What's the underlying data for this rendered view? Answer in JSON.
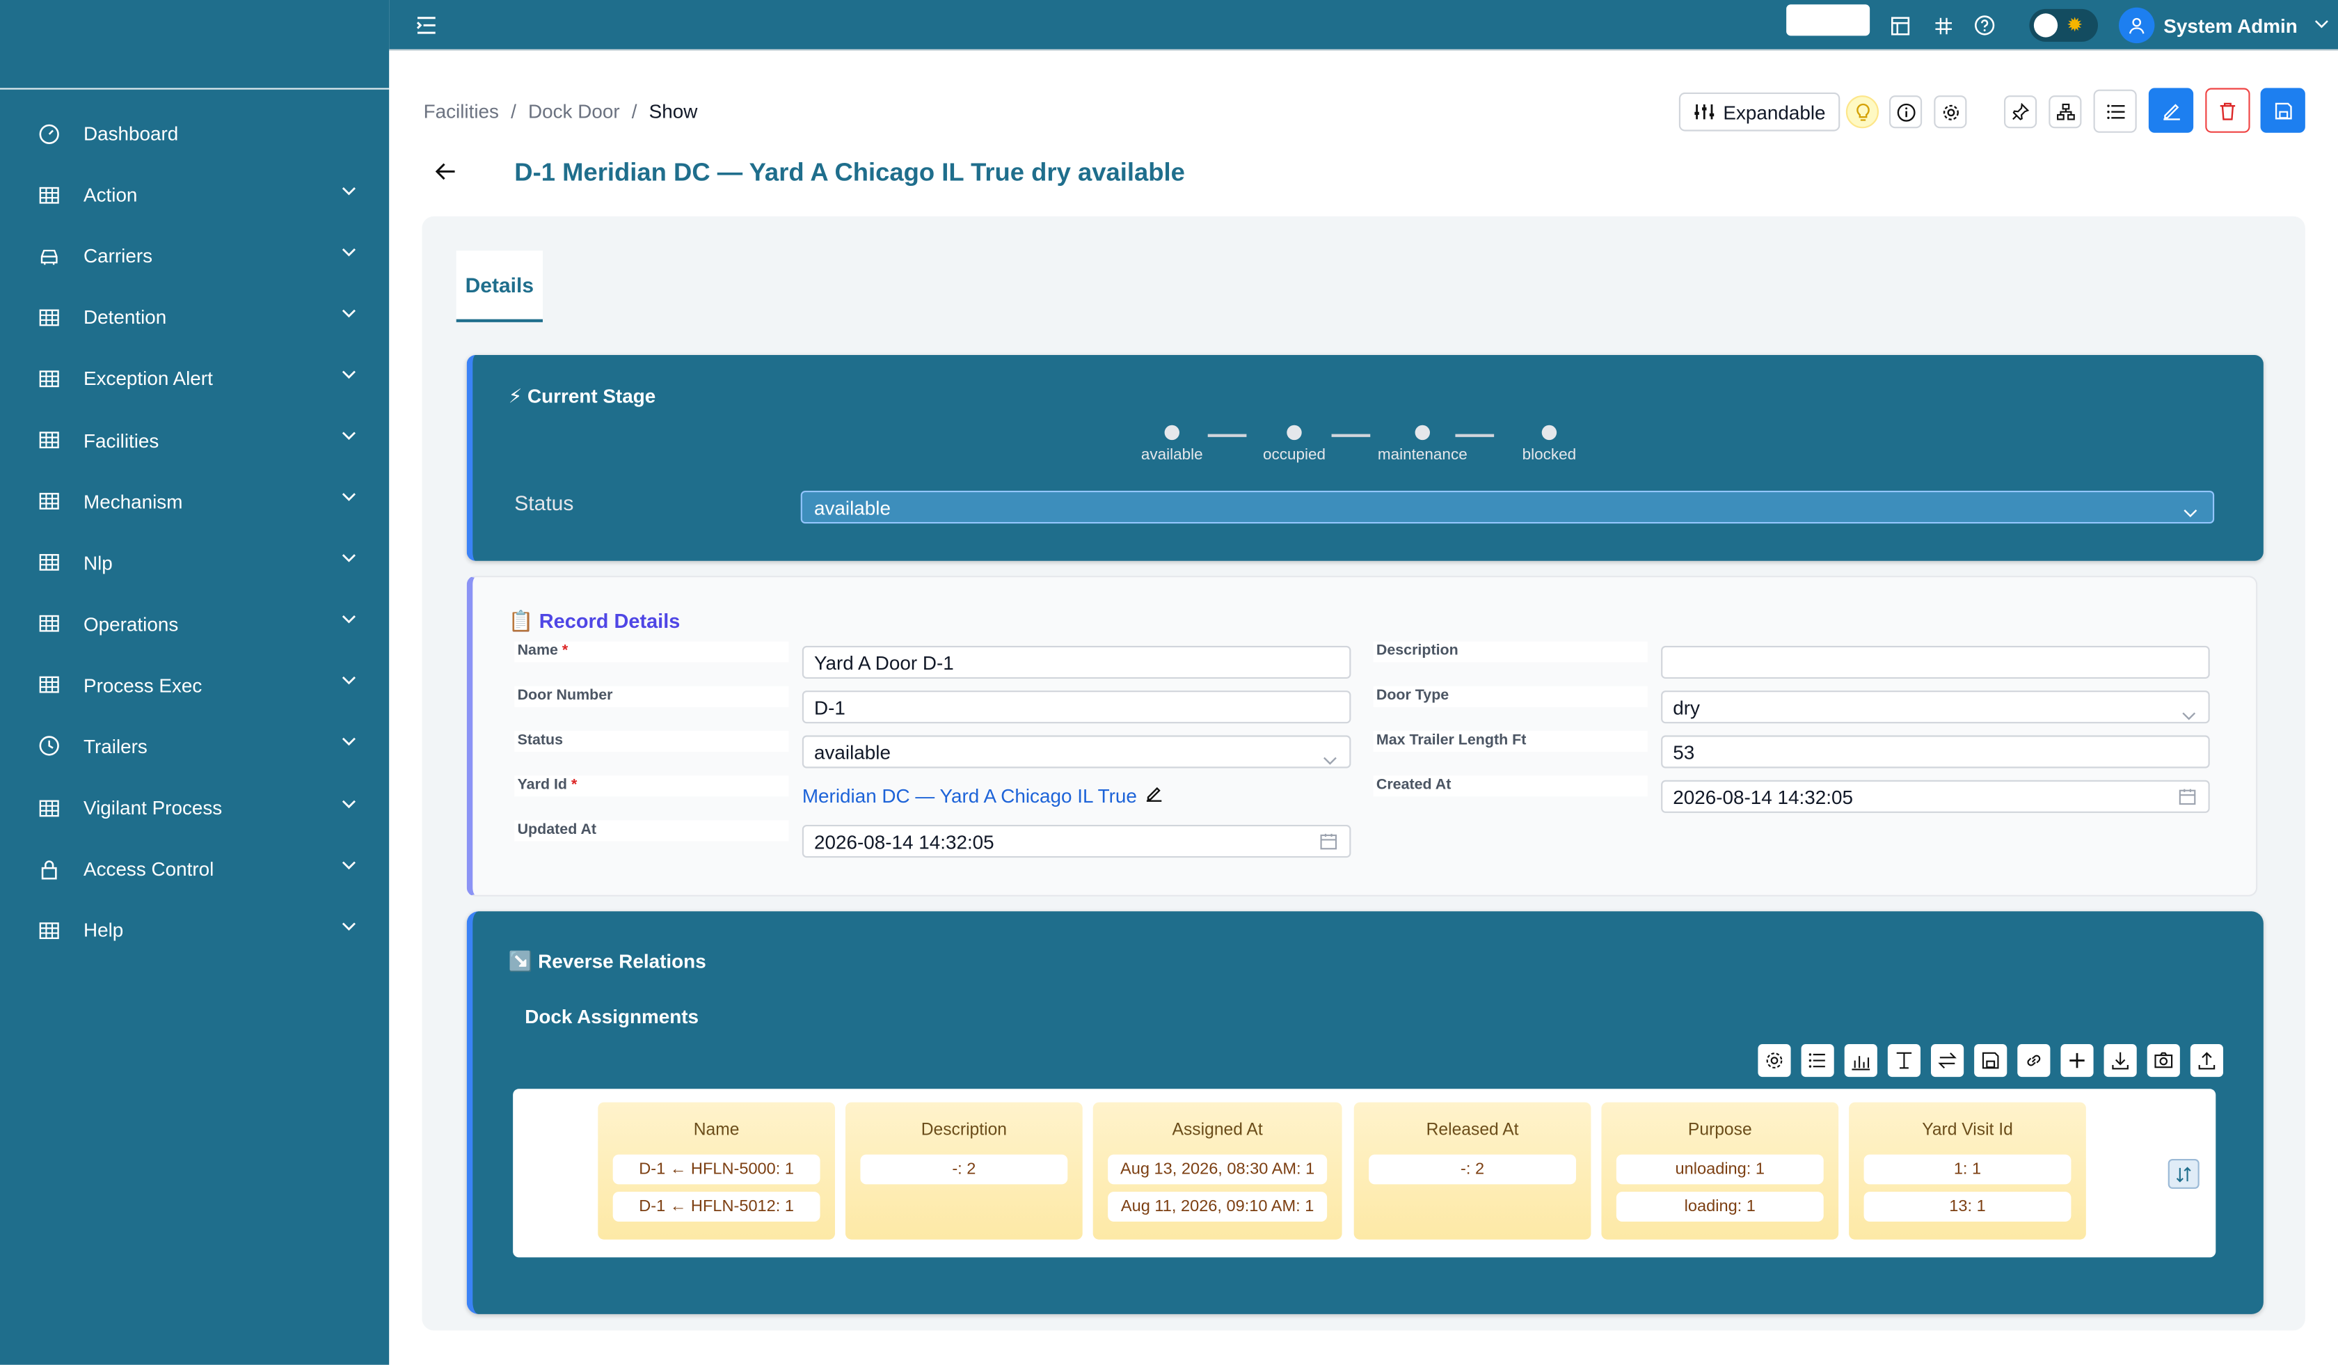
{
  "sidebar": {
    "items": [
      {
        "label": "Dashboard",
        "icon": "gauge-icon",
        "expandable": false
      },
      {
        "label": "Action",
        "icon": "table-icon",
        "expandable": true
      },
      {
        "label": "Carriers",
        "icon": "car-icon",
        "expandable": true
      },
      {
        "label": "Detention",
        "icon": "table-icon",
        "expandable": true
      },
      {
        "label": "Exception Alert",
        "icon": "table-icon",
        "expandable": true
      },
      {
        "label": "Facilities",
        "icon": "table-icon",
        "expandable": true
      },
      {
        "label": "Mechanism",
        "icon": "table-icon",
        "expandable": true
      },
      {
        "label": "Nlp",
        "icon": "table-icon",
        "expandable": true
      },
      {
        "label": "Operations",
        "icon": "table-icon",
        "expandable": true
      },
      {
        "label": "Process Exec",
        "icon": "table-icon",
        "expandable": true
      },
      {
        "label": "Trailers",
        "icon": "clock-icon",
        "expandable": true
      },
      {
        "label": "Vigilant Process",
        "icon": "table-icon",
        "expandable": true
      },
      {
        "label": "Access Control",
        "icon": "lock-icon",
        "expandable": true
      },
      {
        "label": "Help",
        "icon": "table-icon",
        "expandable": true
      }
    ]
  },
  "header": {
    "user_name": "System Admin"
  },
  "breadcrumb": {
    "items": [
      "Facilities",
      "Dock Door"
    ],
    "current": "Show",
    "separator": "/"
  },
  "toolbar": {
    "expandable_label": "Expandable"
  },
  "page": {
    "title": "D-1 Meridian DC — Yard A Chicago IL True dry available"
  },
  "tabs": {
    "details": "Details"
  },
  "stage": {
    "title": "⚡ Current Stage",
    "steps": [
      "available",
      "occupied",
      "maintenance",
      "blocked"
    ],
    "status_label": "Status",
    "status_value": "available"
  },
  "record": {
    "title": "📋 Record Details",
    "name_label": "Name",
    "name_value": "Yard A Door D-1",
    "description_label": "Description",
    "description_value": "",
    "door_number_label": "Door Number",
    "door_number_value": "D-1",
    "door_type_label": "Door Type",
    "door_type_value": "dry",
    "status_label": "Status",
    "status_value": "available",
    "max_trailer_label": "Max Trailer Length Ft",
    "max_trailer_value": "53",
    "yard_id_label": "Yard Id",
    "yard_id_value": "Meridian DC — Yard A Chicago IL True",
    "created_at_label": "Created At",
    "created_at_value": "2026-08-14 14:32:05",
    "updated_at_label": "Updated At",
    "updated_at_value": "2026-08-14 14:32:05",
    "required_mark": "*"
  },
  "relations": {
    "title": "↘️ Reverse Relations",
    "subtitle": "Dock Assignments",
    "columns": [
      {
        "header": "Name",
        "cells": [
          "D-1 ← HFLN-5000: 1",
          "D-1 ← HFLN-5012: 1"
        ]
      },
      {
        "header": "Description",
        "cells": [
          "-: 2"
        ]
      },
      {
        "header": "Assigned At",
        "cells": [
          "Aug 13, 2026, 08:30 AM: 1",
          "Aug 11, 2026, 09:10 AM: 1"
        ]
      },
      {
        "header": "Released At",
        "cells": [
          "-: 2"
        ]
      },
      {
        "header": "Purpose",
        "cells": [
          "unloading: 1",
          "loading: 1"
        ]
      },
      {
        "header": "Yard Visit Id",
        "cells": [
          "1: 1",
          "13: 1"
        ]
      }
    ],
    "tools": [
      "gear-icon",
      "list-icon",
      "bar-chart-icon",
      "text-height-icon",
      "swap-icon",
      "save-icon",
      "link-icon",
      "plus-icon",
      "download-icon",
      "camera-icon",
      "upload-icon"
    ]
  },
  "colors": {
    "primary": "#1f6e8c",
    "accent_blue": "#1d7ff0",
    "danger": "#dc2626",
    "record_title": "#4f46e5",
    "column_fill": "#fde9a6"
  }
}
